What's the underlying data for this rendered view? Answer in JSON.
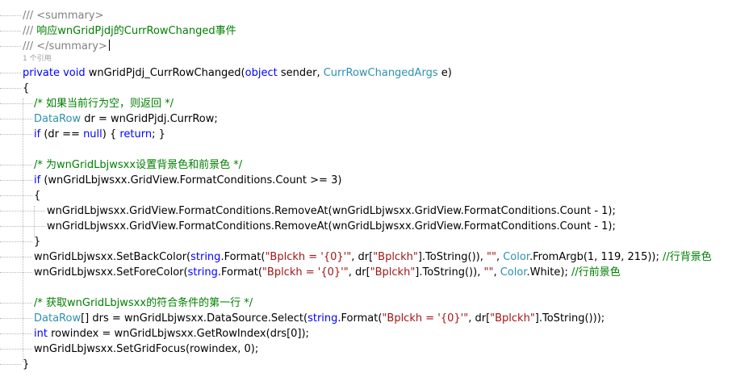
{
  "editor": {
    "lines": [
      [
        {
          "t": "/// <summary>",
          "c": "doc"
        }
      ],
      [
        {
          "t": "/// ",
          "c": "doc"
        },
        {
          "t": "响应wnGridPjdj的CurrRowChanged事件",
          "c": "cm"
        }
      ],
      [
        {
          "t": "/// </summary>",
          "c": "doc"
        }
      ],
      null,
      [
        {
          "t": "private",
          "c": "kw"
        },
        {
          "t": " "
        },
        {
          "t": "void",
          "c": "kw"
        },
        {
          "t": " wnGridPjdj_CurrRowChanged("
        },
        {
          "t": "object",
          "c": "kw"
        },
        {
          "t": " sender, "
        },
        {
          "t": "CurrRowChangedArgs",
          "c": "ty"
        },
        {
          "t": " e)"
        }
      ],
      [
        {
          "t": "{"
        }
      ],
      [
        {
          "t": "/* 如果当前行为空，则返回 */",
          "c": "cm"
        }
      ],
      [
        {
          "t": "DataRow",
          "c": "ty"
        },
        {
          "t": " dr = wnGridPjdj.CurrRow;"
        }
      ],
      [
        {
          "t": "if",
          "c": "kw"
        },
        {
          "t": " (dr == "
        },
        {
          "t": "null",
          "c": "kw"
        },
        {
          "t": ") { "
        },
        {
          "t": "return",
          "c": "kw"
        },
        {
          "t": "; }"
        }
      ],
      [],
      [
        {
          "t": "/* 为wnGridLbjwsxx设置背景色和前景色 */",
          "c": "cm"
        }
      ],
      [
        {
          "t": "if",
          "c": "kw"
        },
        {
          "t": " (wnGridLbjwsxx.GridView.FormatConditions.Count >= 3)"
        }
      ],
      [
        {
          "t": "{"
        }
      ],
      [
        {
          "t": "wnGridLbjwsxx.GridView.FormatConditions.RemoveAt(wnGridLbjwsxx.GridView.FormatConditions.Count - 1);"
        }
      ],
      [
        {
          "t": "wnGridLbjwsxx.GridView.FormatConditions.RemoveAt(wnGridLbjwsxx.GridView.FormatConditions.Count - 1);"
        }
      ],
      [
        {
          "t": "}"
        }
      ],
      [
        {
          "t": "wnGridLbjwsxx.SetBackColor("
        },
        {
          "t": "string",
          "c": "kw"
        },
        {
          "t": ".Format("
        },
        {
          "t": "\"Bplckh = '{0}'\"",
          "c": "st"
        },
        {
          "t": ", dr["
        },
        {
          "t": "\"Bplckh\"",
          "c": "st"
        },
        {
          "t": "].ToString()), "
        },
        {
          "t": "\"\"",
          "c": "st"
        },
        {
          "t": ", "
        },
        {
          "t": "Color",
          "c": "ty"
        },
        {
          "t": ".FromArgb(1, 119, 215)); "
        },
        {
          "t": "//行背景色",
          "c": "cm"
        }
      ],
      [
        {
          "t": "wnGridLbjwsxx.SetForeColor("
        },
        {
          "t": "string",
          "c": "kw"
        },
        {
          "t": ".Format("
        },
        {
          "t": "\"Bplckh = '{0}'\"",
          "c": "st"
        },
        {
          "t": ", dr["
        },
        {
          "t": "\"Bplckh\"",
          "c": "st"
        },
        {
          "t": "].ToString()), "
        },
        {
          "t": "\"\"",
          "c": "st"
        },
        {
          "t": ", "
        },
        {
          "t": "Color",
          "c": "ty"
        },
        {
          "t": ".White); "
        },
        {
          "t": "//行前景色",
          "c": "cm"
        }
      ],
      [],
      [
        {
          "t": "/* 获取wnGridLbjwsxx的符合条件的第一行 */",
          "c": "cm"
        }
      ],
      [
        {
          "t": "DataRow",
          "c": "ty"
        },
        {
          "t": "[] drs = wnGridLbjwsxx.DataSource.Select("
        },
        {
          "t": "string",
          "c": "kw"
        },
        {
          "t": ".Format("
        },
        {
          "t": "\"Bplckh = '{0}'\"",
          "c": "st"
        },
        {
          "t": ", dr["
        },
        {
          "t": "\"Bplckh\"",
          "c": "st"
        },
        {
          "t": "].ToString()));"
        }
      ],
      [
        {
          "t": "int",
          "c": "kw"
        },
        {
          "t": " rowindex = wnGridLbjwsxx.GetRowIndex(drs[0]);"
        }
      ],
      [
        {
          "t": "wnGridLbjwsxx.SetGridFocus(rowindex, 0);"
        }
      ],
      [
        {
          "t": "}"
        }
      ]
    ],
    "codelens": "1 个引用",
    "colors": {
      "keyword": "#0000ff",
      "type": "#2b91af",
      "string": "#a31515",
      "comment": "#008000",
      "doc_tag": "#808080",
      "guide": "#b9b9b9"
    }
  }
}
